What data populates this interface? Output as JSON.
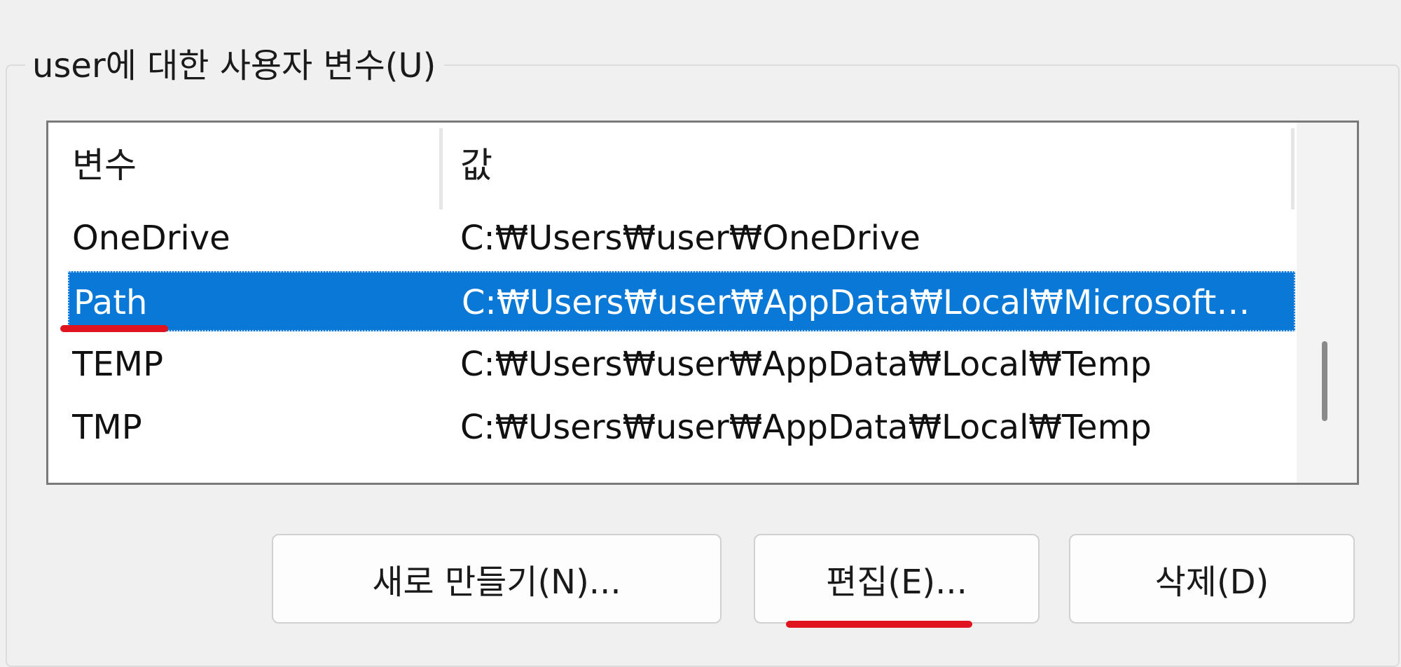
{
  "group": {
    "title": "user에 대한 사용자 변수(U)"
  },
  "list": {
    "columns": [
      "변수",
      "값"
    ],
    "rows": [
      {
        "variable": "OneDrive",
        "value": "C:₩Users₩user₩OneDrive",
        "selected": false
      },
      {
        "variable": "Path",
        "value": "C:₩Users₩user₩AppData₩Local₩Microsoft…",
        "selected": true
      },
      {
        "variable": "TEMP",
        "value": "C:₩Users₩user₩AppData₩Local₩Temp",
        "selected": false
      },
      {
        "variable": "TMP",
        "value": "C:₩Users₩user₩AppData₩Local₩Temp",
        "selected": false
      }
    ]
  },
  "buttons": {
    "new_label": "새로 만들기(N)...",
    "edit_label": "편집(E)...",
    "delete_label": "삭제(D)"
  },
  "colors": {
    "selection": "#0a78d7",
    "annotation": "#e0141e"
  }
}
